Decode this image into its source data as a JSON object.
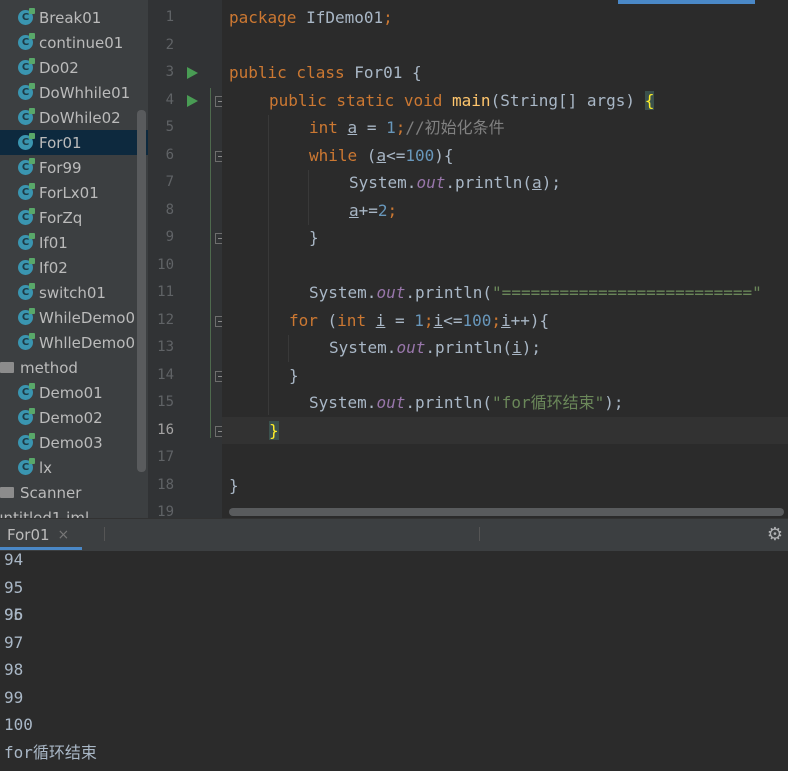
{
  "project_tree": {
    "items": [
      {
        "label": "Break01",
        "kind": "class"
      },
      {
        "label": "continue01",
        "kind": "class"
      },
      {
        "label": "Do02",
        "kind": "class"
      },
      {
        "label": "DoWhhile01",
        "kind": "class"
      },
      {
        "label": "DoWhile02",
        "kind": "class"
      },
      {
        "label": "For01",
        "kind": "class",
        "selected": true
      },
      {
        "label": "For99",
        "kind": "class"
      },
      {
        "label": "ForLx01",
        "kind": "class"
      },
      {
        "label": "ForZq",
        "kind": "class"
      },
      {
        "label": "If01",
        "kind": "class"
      },
      {
        "label": "If02",
        "kind": "class"
      },
      {
        "label": "switch01",
        "kind": "class"
      },
      {
        "label": "WhileDemo0",
        "kind": "class"
      },
      {
        "label": "WhlleDemo0",
        "kind": "class"
      },
      {
        "label": "method",
        "kind": "package"
      },
      {
        "label": "Demo01",
        "kind": "class"
      },
      {
        "label": "Demo02",
        "kind": "class"
      },
      {
        "label": "Demo03",
        "kind": "class"
      },
      {
        "label": "lx",
        "kind": "class"
      },
      {
        "label": "Scanner",
        "kind": "package"
      },
      {
        "label": "untitled1.iml",
        "kind": "file"
      }
    ],
    "class_icon_letter": "C"
  },
  "editor": {
    "line_numbers": [
      "1",
      "2",
      "3",
      "4",
      "5",
      "6",
      "7",
      "8",
      "9",
      "10",
      "11",
      "12",
      "13",
      "14",
      "15",
      "16",
      "17",
      "18",
      "19"
    ],
    "current_line": "16",
    "code": {
      "l1_kw": "package",
      "l1_name": " IfDemo01",
      "l1_semi": ";",
      "l3_kw": "public class",
      "l3_name": " For01 {",
      "l4_kw": "public static void",
      "l4_fn": "main",
      "l4_args": "(String[] args) ",
      "l4_brace": "{",
      "l5_kw": "int",
      "l5_var": "a",
      "l5_eq": " = ",
      "l5_num": "1",
      "l5_semi": ";",
      "l5_cmt": "//初始化条件",
      "l6_kw": "while",
      "l6_open": " (",
      "l6_var": "a",
      "l6_cond": "<=",
      "l6_num": "100",
      "l6_close": "){",
      "l7_pre": "System.",
      "l7_fld": "out",
      "l7_mid": ".println(",
      "l7_var": "a",
      "l7_end": ");",
      "l8_var": "a",
      "l8_op": "+=",
      "l8_num": "2",
      "l8_semi": ";",
      "l9": "}",
      "l11_pre": "System.",
      "l11_fld": "out",
      "l11_mid": ".println(",
      "l11_str": "\"==========================\"",
      "l12_kw": "for",
      "l12_open": " (",
      "l12_kw2": "int",
      "l12_sp": " ",
      "l12_var": "i",
      "l12_eq": " = ",
      "l12_num": "1",
      "l12_semi": ";",
      "l12_var2": "i",
      "l12_cond": "<=",
      "l12_num2": "100",
      "l12_semi2": ";",
      "l12_var3": "i",
      "l12_inc": "++){",
      "l13_pre": "System.",
      "l13_fld": "out",
      "l13_mid": ".println(",
      "l13_var": "i",
      "l13_end": ");",
      "l14": "}",
      "l15_pre": "System.",
      "l15_fld": "out",
      "l15_mid": ".println(",
      "l15_str": "\"for循环结束\"",
      "l15_end": ");",
      "l16": "}",
      "l18": "}"
    }
  },
  "run_panel": {
    "tab_label": "For01",
    "close_glyph": "×",
    "settings_icon": "⚙",
    "output_lines": [
      "94",
      "95",
      "96",
      "97",
      "98",
      "99",
      "100",
      "for循环结束"
    ]
  },
  "colors": {
    "keyword": "#cc7832",
    "number": "#6897bb",
    "method": "#ffc66d",
    "string": "#6a8759",
    "comment": "#808080",
    "field": "#9876aa",
    "text": "#a9b7c6"
  }
}
